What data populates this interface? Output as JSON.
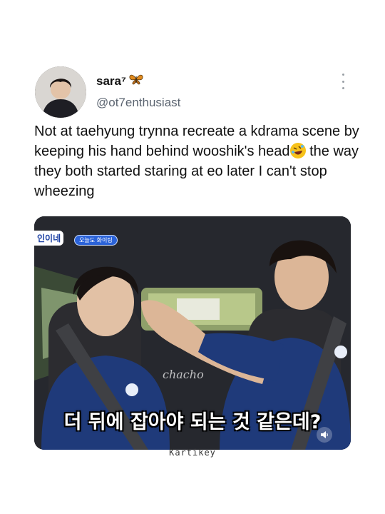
{
  "tweet": {
    "display_name": "sara⁷",
    "name_emoji": "butterfly-icon",
    "handle": "@ot7enthusiast",
    "text_part1": "Not at taehyung trynna recreate a kdrama scene by keeping his hand behind wooshik's head",
    "text_emoji": "rolling-on-floor-laughing-emoji",
    "text_part2": " the way they both started staring at eo later I can't stop wheezing"
  },
  "media": {
    "subtitle": "더 뒤에 잡아야 되는 것 같은데?",
    "watermark": "chacho",
    "show_logo": "인이네",
    "show_pill": "오늘도 화이팅"
  },
  "caption": "Kartikey",
  "colors": {
    "text": "#111111",
    "handle": "#5b6470",
    "media_bg": "#1c1d22",
    "shirt": "#1f3a7a"
  }
}
